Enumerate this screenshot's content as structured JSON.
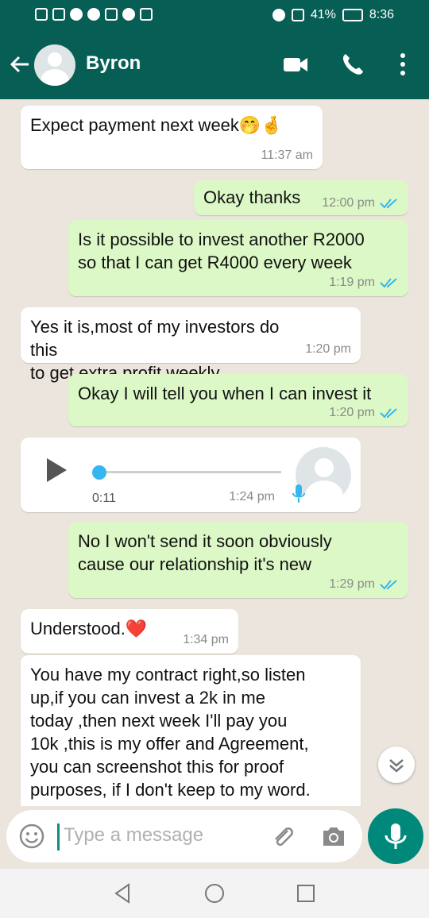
{
  "status_bar": {
    "left_icons": [
      "volte-icon",
      "4g-signal-icon",
      "whatsapp-icon",
      "phone-icon",
      "news-icon",
      "facebook-icon",
      "calendar-icon"
    ],
    "battery_percent": "41%",
    "time": "8:36"
  },
  "header": {
    "contact_name": "Byron"
  },
  "colors": {
    "header_bg": "#075E54",
    "outgoing_bubble": "#DCF8C6",
    "incoming_bubble": "#FFFFFF",
    "read_ticks": "#34B7F1",
    "accent": "#00897B"
  },
  "messages": [
    {
      "dir": "in",
      "text": "Expect payment next week",
      "emoji": "🤭🤞",
      "time": "11:37 am"
    },
    {
      "dir": "out",
      "text": "Okay thanks",
      "time": "12:00 pm",
      "read": true
    },
    {
      "dir": "out",
      "text": "Is it possible to invest another R2000\nso that I can get R4000 every week",
      "time": "1:19 pm",
      "read": true
    },
    {
      "dir": "in",
      "text": "Yes it is,most of my investors do this\nto get extra profit weekly.",
      "time": "1:20 pm"
    },
    {
      "dir": "out",
      "text": "Okay I will tell you when I can invest it",
      "time": "1:20 pm",
      "read": true
    },
    {
      "dir": "in",
      "type": "audio",
      "duration": "0:11",
      "time": "1:24 pm"
    },
    {
      "dir": "out",
      "text": "No I won't send it soon obviously\ncause our relationship it's new",
      "time": "1:29 pm",
      "read": true
    },
    {
      "dir": "in",
      "text": "Understood.",
      "emoji": "❤️",
      "time": "1:34 pm"
    },
    {
      "dir": "in",
      "text": "You have my contract right,so listen\nup,if you can invest a 2k in me\ntoday ,then next week I'll pay you\n10k ,this is my offer and Agreement,\nyou can screenshot this for proof\npurposes, if I don't keep to my word."
    }
  ],
  "input": {
    "placeholder": "Type a message"
  }
}
